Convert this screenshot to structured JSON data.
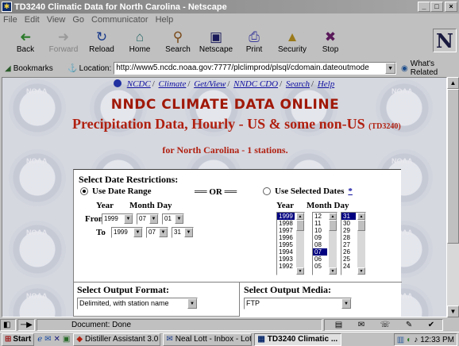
{
  "window": {
    "title": "TD3240 Climatic Data for North Carolina - Netscape",
    "buttons": {
      "minimize": "_",
      "maximize": "□",
      "close": "×"
    }
  },
  "menu": [
    "File",
    "Edit",
    "View",
    "Go",
    "Communicator",
    "Help"
  ],
  "toolbar": [
    {
      "label": "Back",
      "icon": "back-arrow-icon",
      "glyph": "➜",
      "enabled": true
    },
    {
      "label": "Forward",
      "icon": "forward-arrow-icon",
      "glyph": "➜",
      "enabled": false
    },
    {
      "label": "Reload",
      "icon": "reload-icon",
      "glyph": "↻",
      "enabled": true
    },
    {
      "label": "Home",
      "icon": "home-icon",
      "glyph": "⌂",
      "enabled": true
    },
    {
      "label": "Search",
      "icon": "search-icon",
      "glyph": "⚲",
      "enabled": true
    },
    {
      "label": "Netscape",
      "icon": "netscape-icon",
      "glyph": "▣",
      "enabled": true
    },
    {
      "label": "Print",
      "icon": "print-icon",
      "glyph": "⎙",
      "enabled": true
    },
    {
      "label": "Security",
      "icon": "security-lock-icon",
      "glyph": "🔒",
      "enabled": true
    },
    {
      "label": "Stop",
      "icon": "stop-icon",
      "glyph": "⛔",
      "enabled": true
    }
  ],
  "logo": "N",
  "location": {
    "bookmarks_label": "Bookmarks",
    "location_label": "Location:",
    "url": "http://www5.ncdc.noaa.gov:7777/plclimprod/plsql/cdomain.dateoutmode",
    "whats_related": "What's Related"
  },
  "page": {
    "nav_links": [
      "NCDC",
      "Climate",
      "Get/View",
      "NNDC CDO",
      "Search",
      "Help"
    ],
    "heading": "NNDC CLIMATE DATA ONLINE",
    "title_main": "Precipitation Data, Hourly - US & some non-US",
    "title_code": "(TD3240)",
    "subtitle": "for North Carolina - 1 stations.",
    "watermark": "NOAA",
    "date_section": {
      "title": "Select Date Restrictions:",
      "use_range_label": "Use Date Range",
      "or_label": "══ OR ══",
      "use_selected_label": "Use Selected Dates",
      "asterisk": "*",
      "range_mode_selected": true,
      "col_year": "Year",
      "col_month_day": "Month Day",
      "from_label": "From",
      "to_label": "To",
      "from": {
        "year": "1999",
        "month": "07",
        "day": "01"
      },
      "to": {
        "year": "1999",
        "month": "07",
        "day": "31"
      },
      "years": [
        "1999",
        "1998",
        "1997",
        "1996",
        "1995",
        "1994",
        "1993",
        "1992"
      ],
      "months": [
        "12",
        "11",
        "10",
        "09",
        "08",
        "07",
        "06",
        "05"
      ],
      "days": [
        "31",
        "30",
        "29",
        "28",
        "27",
        "26",
        "25",
        "24"
      ],
      "selected_year": "1999",
      "selected_month": "07",
      "selected_day": "31"
    },
    "output_format": {
      "title": "Select Output Format:",
      "value": "Delimited, with station name"
    },
    "output_media": {
      "title": "Select Output Media:",
      "value": "FTP"
    }
  },
  "status": {
    "text": "Document: Done"
  },
  "taskbar": {
    "start": "Start",
    "tasks": [
      {
        "label": "Distiller Assistant 3.0",
        "active": false
      },
      {
        "label": "Neal Lott - Inbox - Lot...",
        "active": false
      },
      {
        "label": "TD3240 Climatic ...",
        "active": true
      }
    ],
    "clock": "12:33 PM"
  },
  "colors": {
    "heading_red": "#a01808",
    "link_blue": "#1010a0",
    "selection_navy": "#000080"
  }
}
